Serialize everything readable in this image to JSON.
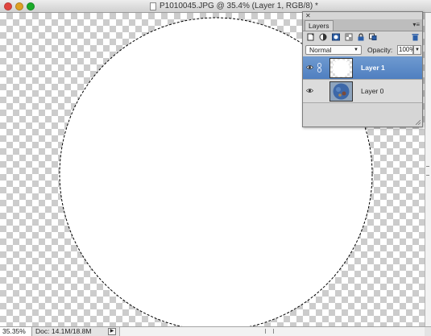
{
  "window": {
    "title": "P1010045.JPG @ 35.4% (Layer 1, RGB/8) *",
    "buttons": [
      "close",
      "minimize",
      "zoom"
    ]
  },
  "canvas": {
    "background": "transparency-checkerboard",
    "selection": "marching-ants-circle",
    "fill_color": "#ffffff"
  },
  "status": {
    "zoom": "35.35%",
    "doc_info": "Doc: 14.1M/18.8M"
  },
  "layers_panel": {
    "tab_label": "Layers",
    "icons": [
      "new-layer-icon",
      "adjustment-layer-icon",
      "layer-mask-icon",
      "lock-transparent-icon",
      "lock-all-icon",
      "trash-icon"
    ],
    "blend_mode": "Normal",
    "opacity_label": "Opacity:",
    "opacity_value": "100%",
    "layers": [
      {
        "name": "Layer 1",
        "selected": true,
        "visible": true
      },
      {
        "name": "Layer 0",
        "selected": false,
        "visible": true
      }
    ]
  },
  "colors": {
    "selection_highlight": "#5684c4",
    "panel_bg": "#d6d6d6"
  }
}
